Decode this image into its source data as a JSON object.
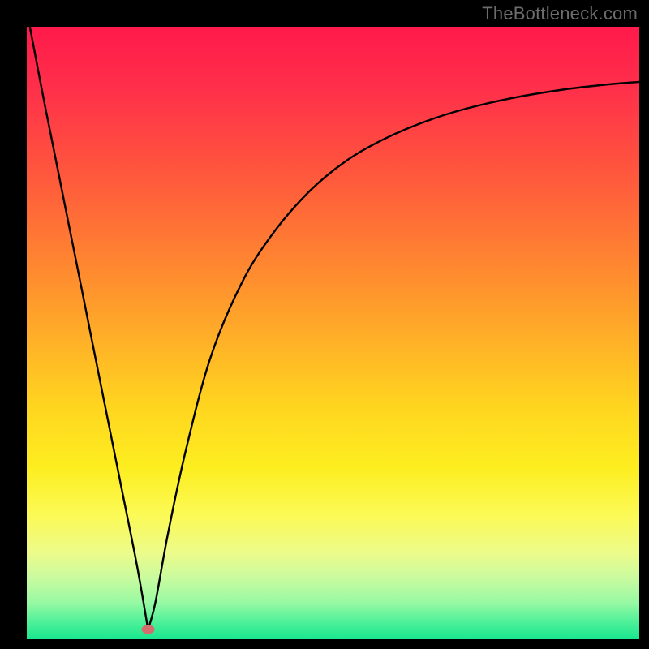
{
  "watermark": "TheBottleneck.com",
  "chart_data": {
    "type": "line",
    "title": "",
    "xlabel": "",
    "ylabel": "",
    "xlim": [
      0,
      100
    ],
    "ylim": [
      0,
      100
    ],
    "series": [
      {
        "name": "bottleneck-curve",
        "x": [
          0.5,
          3,
          6,
          9,
          12,
          15,
          18,
          19.8,
          21,
          23,
          26,
          30,
          35,
          40,
          46,
          52,
          58,
          65,
          72,
          80,
          88,
          95,
          100
        ],
        "y": [
          100,
          87,
          72,
          57,
          42,
          27,
          12,
          1.6,
          6,
          17,
          31,
          46,
          58,
          66,
          73,
          78,
          81.5,
          84.5,
          86.7,
          88.5,
          89.8,
          90.6,
          91
        ]
      }
    ],
    "markers": [
      {
        "name": "min-marker",
        "x": 19.8,
        "y": 1.6,
        "color": "#d46d6d"
      }
    ],
    "background": {
      "type": "vertical-gradient",
      "stops": [
        {
          "pos": 0.0,
          "color": "#ff1a4b"
        },
        {
          "pos": 0.4,
          "color": "#ff8a2f"
        },
        {
          "pos": 0.72,
          "color": "#fdee20"
        },
        {
          "pos": 1.0,
          "color": "#18e78f"
        }
      ]
    }
  }
}
